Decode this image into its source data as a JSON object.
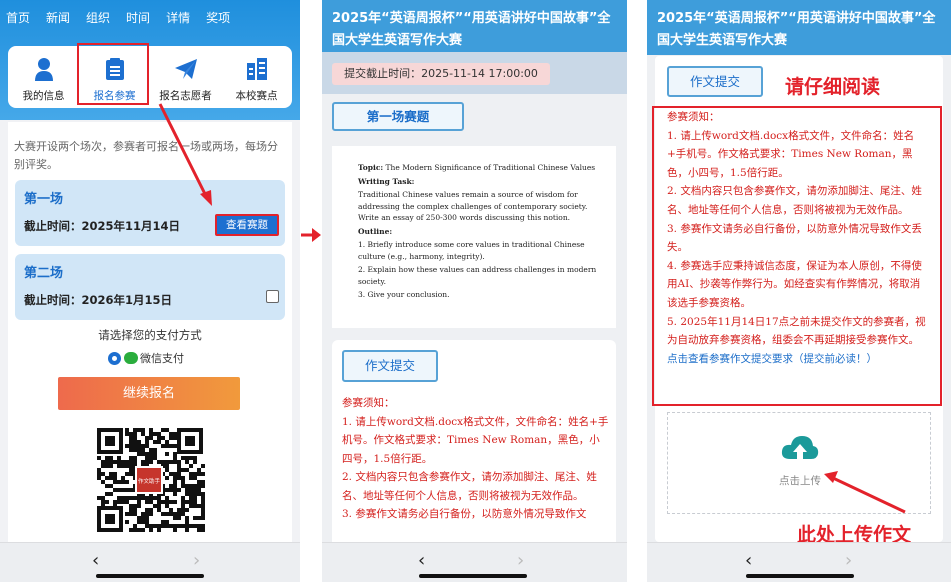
{
  "screen1": {
    "nav_tabs": [
      "首页",
      "新闻",
      "组织",
      "时间",
      "详情",
      "奖项"
    ],
    "quick_actions": [
      {
        "label": "我的信息",
        "icon": "user-icon"
      },
      {
        "label": "报名参赛",
        "icon": "clipboard-icon"
      },
      {
        "label": "报名志愿者",
        "icon": "paper-plane-icon"
      },
      {
        "label": "本校赛点",
        "icon": "building-icon"
      }
    ],
    "intro": "大赛开设两个场次，参赛者可报名一场或两场，每场分别评奖。",
    "rounds": [
      {
        "name": "第一场",
        "deadline": "截止时间：2025年11月14日",
        "button": "查看赛题"
      },
      {
        "name": "第二场",
        "deadline": "截止时间：2026年1月15日"
      }
    ],
    "payment_prompt": "请选择您的支付方式",
    "payment_method": "微信支付",
    "continue_button": "继续报名",
    "qr_caption": "作文助手"
  },
  "screen2": {
    "title": "2025年“英语周报杯”“用英语讲好中国故事”全国大学生英语写作大赛",
    "deadline": "提交截止时间：2025-11-14 17:00:00",
    "round_tab": "第一场赛题",
    "prompt": {
      "topic_label": "Topic:",
      "topic": "The Modern Significance of Traditional Chinese Values",
      "task_label": "Writing Task:",
      "task": "Traditional Chinese values remain a source of wisdom for addressing the complex challenges of contemporary society. Write an essay of 250-300 words discussing this notion.",
      "outline_label": "Outline:",
      "outline": [
        "1.  Briefly introduce some core values in traditional Chinese culture (e.g., harmony, integrity).",
        "2.  Explain how these values can address challenges in modern society.",
        "3.  Give your conclusion."
      ]
    },
    "submit_tab": "作文提交",
    "notice_title": "参赛须知：",
    "notice_items": [
      "1. 请上传word文档.docx格式文件，文件命名：姓名+手机号。作文格式要求：Times New Roman，黑色，小四号，1.5倍行距。",
      "2. 文档内容只包含参赛作文，请勿添加脚注、尾注、姓名、地址等任何个人信息，否则将被视为无效作品。",
      "3. 参赛作文请务必自行备份，以防意外情况导致作文"
    ]
  },
  "screen3": {
    "title": "2025年“英语周报杯”“用英语讲好中国故事”全国大学生英语写作大赛",
    "submit_tab": "作文提交",
    "annotation_read": "请仔细阅读",
    "notice_title": "参赛须知：",
    "notice_items": [
      "1. 请上传word文档.docx格式文件，文件命名：姓名+手机号。作文格式要求：Times New Roman，黑色，小四号，1.5倍行距。",
      "2. 文档内容只包含参赛作文，请勿添加脚注、尾注、姓名、地址等任何个人信息，否则将被视为无效作品。",
      "3. 参赛作文请务必自行备份，以防意外情况导致作文丢失。",
      "4. 参赛选手应秉持诚信态度，保证为本人原创，不得使用AI、抄袭等作弊行为。如经查实有作弊情况，将取消该选手参赛资格。",
      "5. 2025年11月14日17点之前未提交作文的参赛者，视为自动放弃参赛资格，组委会不再延期接受参赛作文。"
    ],
    "requirements_link": "点击查看参赛作文提交要求（提交前必读！）",
    "upload_label": "点击上传",
    "annotation_upload": "此处上传作文"
  },
  "nav": {
    "back": "‹",
    "forward": "›"
  },
  "colors": {
    "primary": "#1d6fd0",
    "header": "#3e9ddb",
    "annotation": "#e3222b",
    "notice": "#d4201d"
  }
}
